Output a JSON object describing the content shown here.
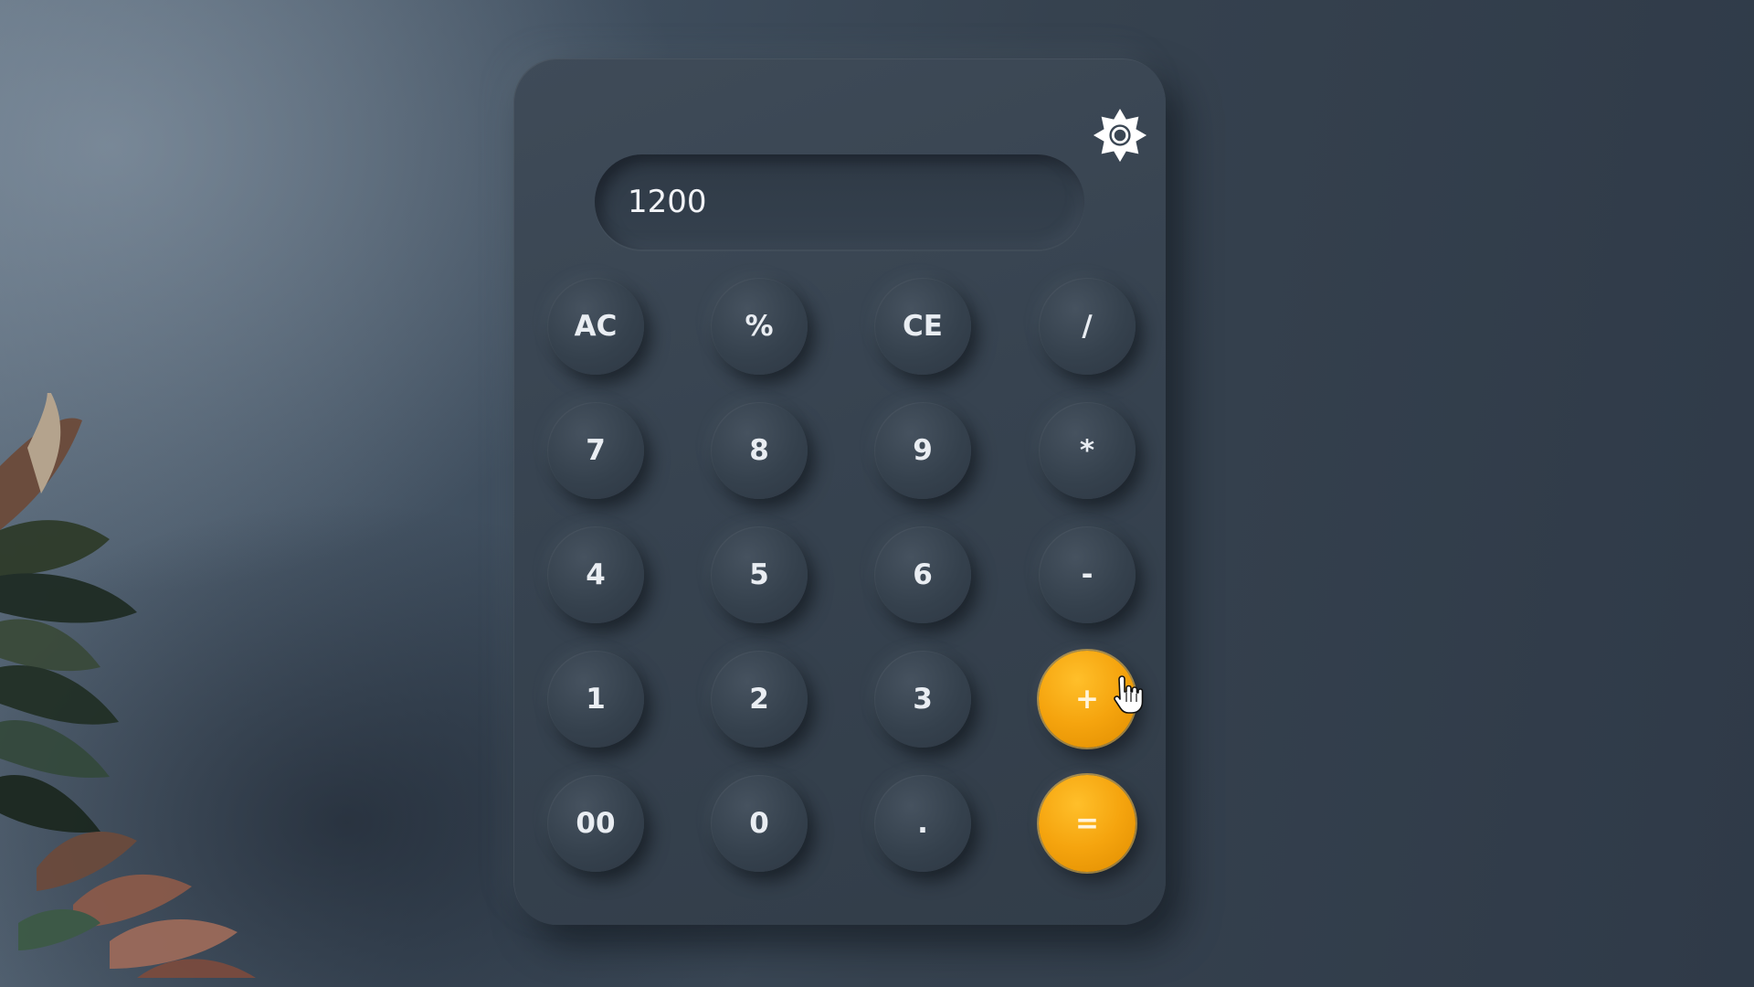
{
  "display": {
    "value": "1200"
  },
  "icons": {
    "settings": "gear-icon",
    "cursor": "hand-pointer-icon",
    "plant": "plant-decoration"
  },
  "colors": {
    "accent": "#f5a40e",
    "panel": "#36424f",
    "key_text": "#e9edf2"
  },
  "keys": {
    "ac": "AC",
    "percent": "%",
    "ce": "CE",
    "divide": "/",
    "seven": "7",
    "eight": "8",
    "nine": "9",
    "multiply": "*",
    "four": "4",
    "five": "5",
    "six": "6",
    "minus": "-",
    "one": "1",
    "two": "2",
    "three": "3",
    "plus": "+",
    "double_zero": "00",
    "zero": "0",
    "decimal": ".",
    "equals": "="
  }
}
